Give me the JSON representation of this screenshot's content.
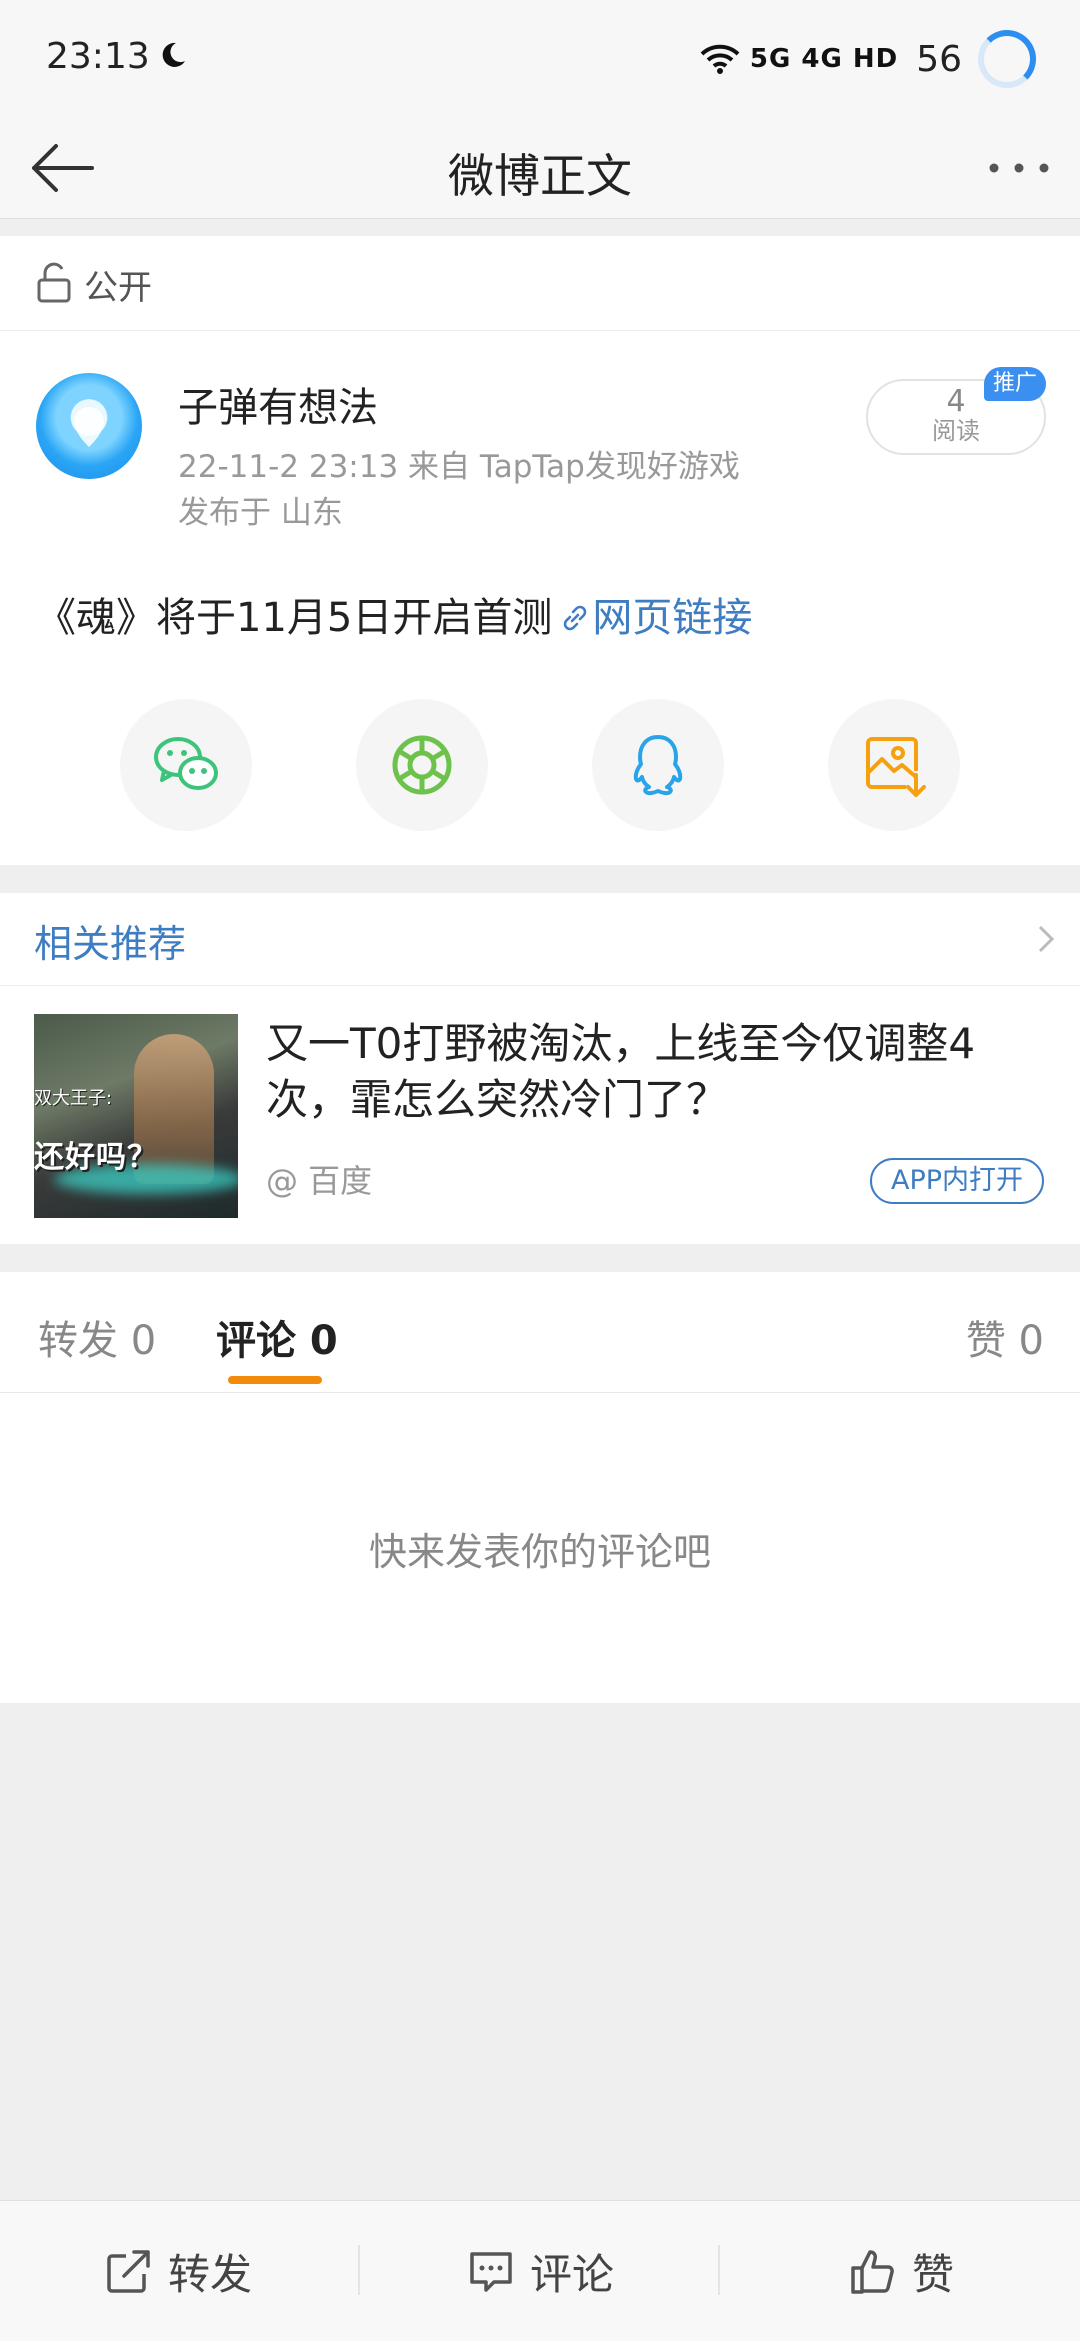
{
  "status_bar": {
    "time": "23:13",
    "network": "5G 4G HD",
    "battery": "56"
  },
  "nav": {
    "title": "微博正文"
  },
  "visibility": {
    "label": "公开"
  },
  "post": {
    "author": "子弹有想法",
    "meta_line": "22-11-2 23:13   来自 TapTap发现好游戏",
    "location": "发布于 山东",
    "reads_count": "4",
    "reads_label": "阅读",
    "promo_badge": "推广",
    "text": "《魂》将于11月5日开启首测",
    "link_text": "网页链接"
  },
  "share": {
    "icons": [
      "wechat-icon",
      "moments-icon",
      "qq-icon",
      "save-image-icon"
    ]
  },
  "recommend": {
    "header": "相关推荐",
    "headline": "又一T0打野被淘汰，上线至今仅调整4次，霏怎么突然冷门了？",
    "source": "@ 百度",
    "open_app": "APP内打开",
    "thumb_top": "双大王子:",
    "thumb_text": "还好吗？"
  },
  "tabs": {
    "repost": "转发 0",
    "comment": "评论 0",
    "like": "赞 0"
  },
  "comments": {
    "empty_text": "快来发表你的评论吧"
  },
  "bottom_bar": {
    "repost": "转发",
    "comment": "评论",
    "like": "赞"
  },
  "colors": {
    "link_blue": "#3e7dc1",
    "accent_orange": "#f28a0a",
    "wechat_green": "#3cc57a",
    "moments_green": "#6cc24a",
    "qq_blue": "#2aa4e8",
    "save_orange": "#f5a10f"
  }
}
